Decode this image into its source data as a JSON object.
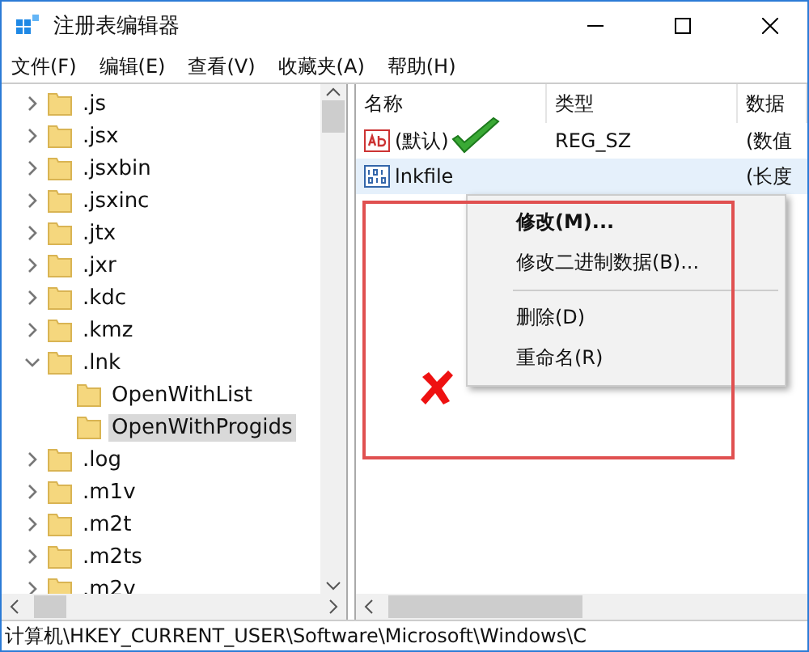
{
  "window": {
    "title": "注册表编辑器"
  },
  "menu": [
    "文件(F)",
    "编辑(E)",
    "查看(V)",
    "收藏夹(A)",
    "帮助(H)"
  ],
  "tree": [
    {
      "label": ".js",
      "expanded": false,
      "selected": false
    },
    {
      "label": ".jsx",
      "expanded": false,
      "selected": false
    },
    {
      "label": ".jsxbin",
      "expanded": false,
      "selected": false
    },
    {
      "label": ".jsxinc",
      "expanded": false,
      "selected": false
    },
    {
      "label": ".jtx",
      "expanded": false,
      "selected": false
    },
    {
      "label": ".jxr",
      "expanded": false,
      "selected": false
    },
    {
      "label": ".kdc",
      "expanded": false,
      "selected": false
    },
    {
      "label": ".kmz",
      "expanded": false,
      "selected": false
    },
    {
      "label": ".lnk",
      "expanded": true,
      "selected": false,
      "children": [
        {
          "label": "OpenWithList",
          "selected": false
        },
        {
          "label": "OpenWithProgids",
          "selected": true
        }
      ]
    },
    {
      "label": ".log",
      "expanded": false,
      "selected": false
    },
    {
      "label": ".m1v",
      "expanded": false,
      "selected": false
    },
    {
      "label": ".m2t",
      "expanded": false,
      "selected": false
    },
    {
      "label": ".m2ts",
      "expanded": false,
      "selected": false
    },
    {
      "label": ".m2v",
      "expanded": false,
      "selected": false
    }
  ],
  "values": {
    "columns": [
      "名称",
      "类型",
      "数据"
    ],
    "rows": [
      {
        "kind": "string",
        "name": "(默认)",
        "type": "REG_SZ",
        "data": "(数值",
        "selected": false
      },
      {
        "kind": "binary",
        "name": "lnkfile",
        "data": "(长度",
        "selected": true
      }
    ]
  },
  "context_menu": [
    {
      "label": "修改(M)...",
      "default": true
    },
    {
      "label": "修改二进制数据(B)...",
      "default": false
    },
    {
      "kind": "separator"
    },
    {
      "label": "删除(D)",
      "default": false
    },
    {
      "label": "重命名(R)",
      "default": false
    }
  ],
  "status_bar": "计算机\\HKEY_CURRENT_USER\\Software\\Microsoft\\Windows\\C"
}
